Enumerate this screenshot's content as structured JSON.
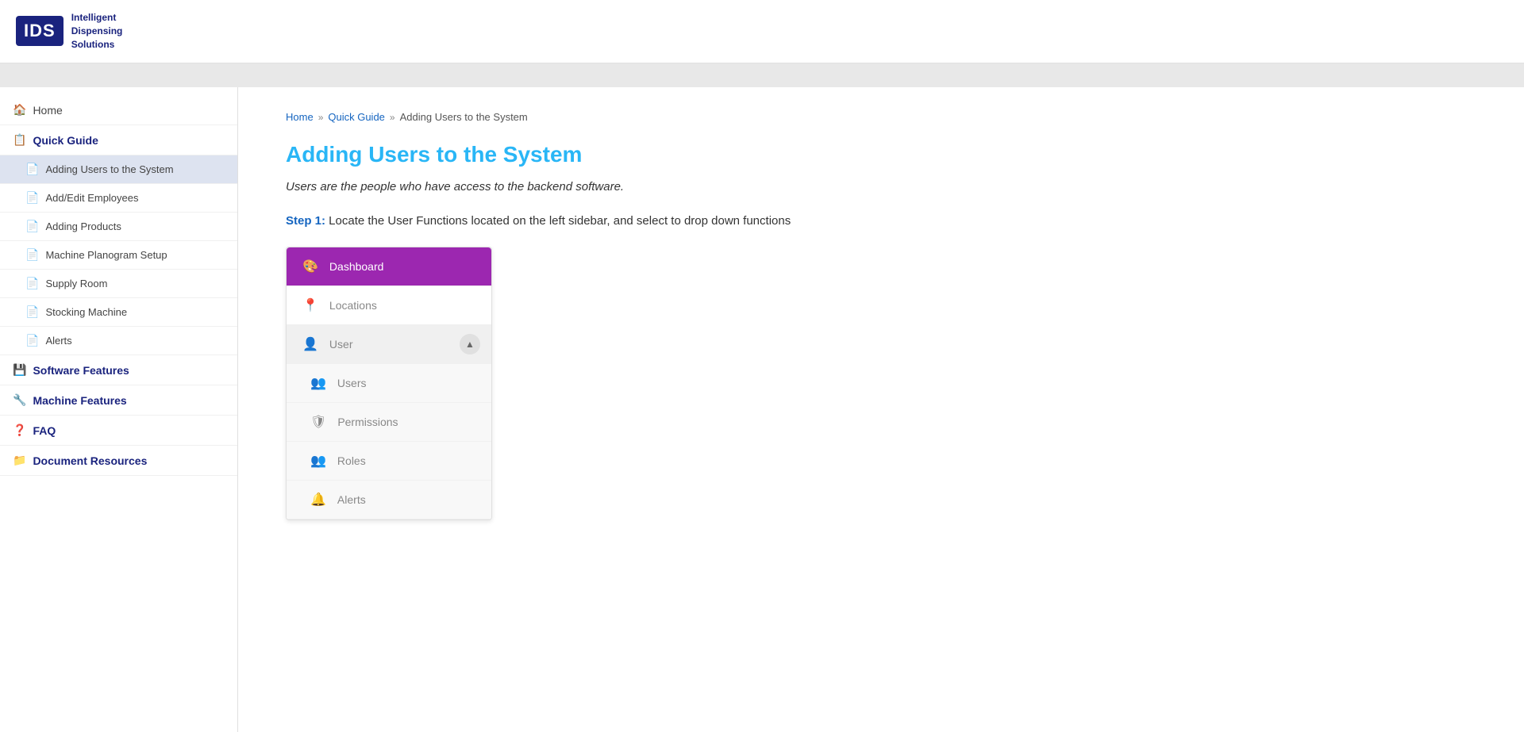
{
  "header": {
    "logo_text": "IDS",
    "logo_subtitle": "Intelligent\nDispensing\nSolutions"
  },
  "sidebar": {
    "home_label": "Home",
    "quick_guide_label": "Quick Guide",
    "items": [
      {
        "id": "adding-users",
        "label": "Adding Users to the System",
        "active": true
      },
      {
        "id": "add-edit-employees",
        "label": "Add/Edit Employees",
        "active": false
      },
      {
        "id": "adding-products",
        "label": "Adding Products",
        "active": false
      },
      {
        "id": "machine-planogram",
        "label": "Machine Planogram Setup",
        "active": false
      },
      {
        "id": "supply-room",
        "label": "Supply Room",
        "active": false
      },
      {
        "id": "stocking-machine",
        "label": "Stocking Machine",
        "active": false
      },
      {
        "id": "alerts",
        "label": "Alerts",
        "active": false
      }
    ],
    "software_features_label": "Software Features",
    "machine_features_label": "Machine Features",
    "faq_label": "FAQ",
    "document_resources_label": "Document Resources"
  },
  "breadcrumb": {
    "home": "Home",
    "quick_guide": "Quick Guide",
    "current": "Adding Users to the System"
  },
  "main": {
    "page_title": "Adding Users to the System",
    "intro_text": "Users are the people who have access to the backend software.",
    "step1_label": "Step 1:",
    "step1_text": " Locate the User Functions located on the left sidebar, and select to drop down functions"
  },
  "mock_ui": {
    "dashboard_label": "Dashboard",
    "locations_label": "Locations",
    "user_label": "User",
    "users_label": "Users",
    "permissions_label": "Permissions",
    "roles_label": "Roles",
    "alerts_label": "Alerts"
  },
  "icons": {
    "home": "🏠",
    "book": "📋",
    "page": "📄",
    "software": "💾",
    "machine": "🔧",
    "faq": "❓",
    "document": "📁",
    "dashboard": "🎨",
    "location": "📍",
    "user": "👤",
    "users": "👥",
    "shield": "🛡",
    "roles": "👥",
    "bell": "🔔",
    "chevron_up": "▲"
  }
}
